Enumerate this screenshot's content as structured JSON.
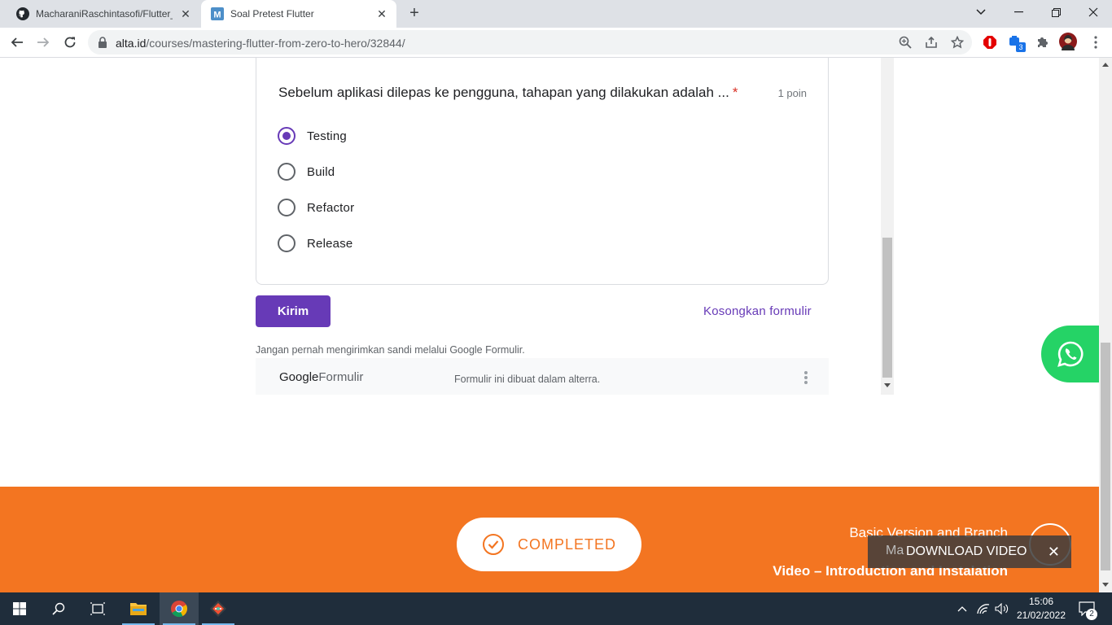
{
  "browser": {
    "tabs": [
      {
        "title": "MacharaniRaschintasofi/Flutter_M",
        "favicon": "github-icon"
      },
      {
        "title": "Soal Pretest Flutter",
        "favicon": "m-icon"
      }
    ],
    "url_host": "alta.id",
    "url_path": "/courses/mastering-flutter-from-zero-to-hero/32844/",
    "extension_badge": "3"
  },
  "form": {
    "question": "Sebelum aplikasi dilepas ke pengguna, tahapan yang dilakukan adalah ...",
    "required_mark": "*",
    "points": "1 poin",
    "options": [
      "Testing",
      "Build",
      "Refactor",
      "Release"
    ],
    "selected_option": "Testing",
    "submit_label": "Kirim",
    "clear_label": "Kosongkan formulir",
    "warning": "Jangan pernah mengirimkan sandi melalui Google Formulir.",
    "logo_google": "Google",
    "logo_formulir": "Formulir",
    "made_in": "Formulir ini dibuat dalam alterra."
  },
  "course_nav": {
    "completed_label": "COMPLETED",
    "next_lesson": "Basic Version and Branch",
    "next_lesson_partial": "Ma",
    "prev_lesson": "Video – Introduction and Instalation",
    "download_video": "DOWNLOAD VIDEO"
  },
  "taskbar": {
    "time": "15:06",
    "date": "21/02/2022",
    "notifications": "2"
  },
  "colors": {
    "accent": "#673ab7",
    "orange": "#f37521",
    "whatsapp": "#25d366"
  }
}
